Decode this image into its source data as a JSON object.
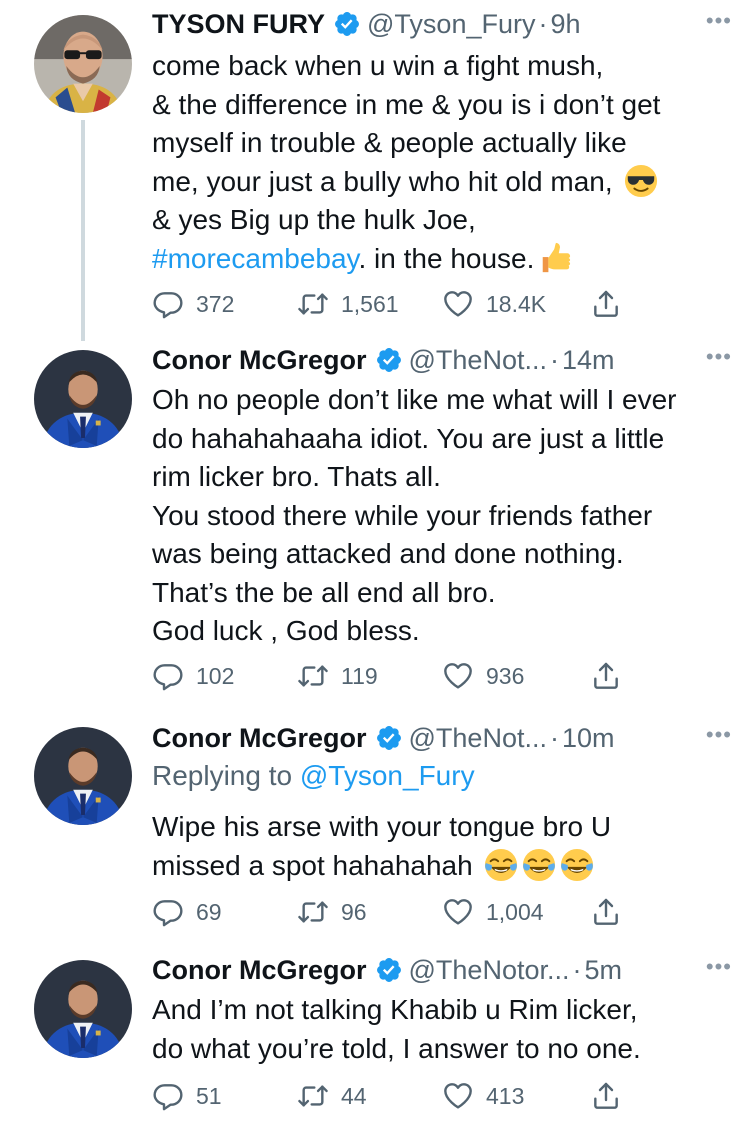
{
  "tweets": [
    {
      "name": "TYSON FURY",
      "handle": "@Tyson_Fury",
      "dot": "·",
      "time": "9h",
      "more": "•••",
      "text_1": "come back when u win a fight mush,\n& the difference in me & you is i don’t get\nmyself in trouble & people actually like\nme, your just a bully who hit old man, ",
      "emoji_1": "smiling-face-with-sunglasses",
      "text_2": "\n& yes Big up the hulk Joe,\n",
      "hashtag": "#morecambebay",
      "text_3": ". in the house.",
      "emoji_2": "thumbs-up",
      "replies": "372",
      "retweets": "1,561",
      "likes": "18.4K"
    },
    {
      "name": "Conor McGregor",
      "handle": "@TheNot...",
      "dot": "·",
      "time": "14m",
      "more": "•••",
      "text": "Oh no people don’t like me what will I ever\ndo hahahahaaha idiot. You are just a little\nrim licker bro. Thats all.\nYou stood there while your friends father\nwas being attacked and done nothing.\nThat’s the be all end all bro.\nGod luck , God bless.",
      "replies": "102",
      "retweets": "119",
      "likes": "936"
    },
    {
      "name": "Conor McGregor",
      "handle": "@TheNot...",
      "dot": "·",
      "time": "10m",
      "more": "•••",
      "replying_prefix": "Replying to ",
      "replying_to": "@Tyson_Fury",
      "text": "Wipe his arse with your tongue bro U\nmissed a spot hahahahah ",
      "emoji": "face-with-tears-of-joy",
      "replies": "69",
      "retweets": "96",
      "likes": "1,004"
    },
    {
      "name": "Conor McGregor",
      "handle": "@TheNotor...",
      "dot": "·",
      "time": "5m",
      "more": "•••",
      "text": "And I’m not talking Khabib u Rim licker,\ndo what you’re told, I answer to no one.",
      "replies": "51",
      "retweets": "44",
      "likes": "413"
    }
  ],
  "colors": {
    "text": "#0f1419",
    "secondary": "#536471",
    "link": "#1d9bf0",
    "verified": "#1d9bf0",
    "thread_line": "#cfd9de"
  },
  "icons": {
    "reply": "reply-icon",
    "retweet": "retweet-icon",
    "like": "heart-icon",
    "share": "share-icon",
    "verified": "verified-badge-icon",
    "more": "more-icon"
  }
}
